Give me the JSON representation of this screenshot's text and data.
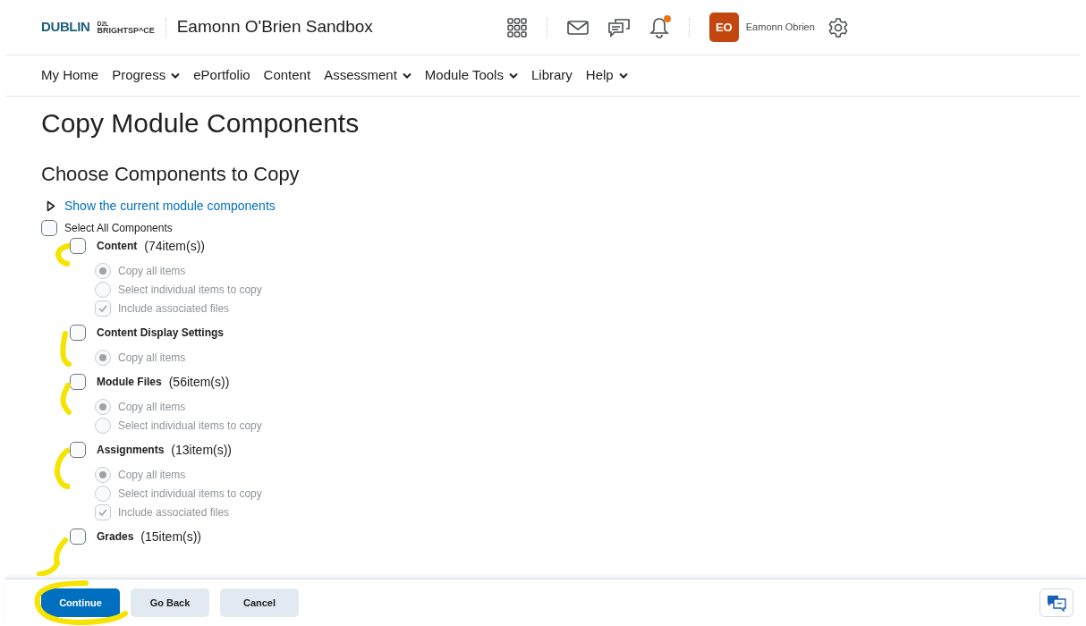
{
  "header": {
    "logo_text": "DUBLIN",
    "brand": "BRIGHTSP^CE",
    "brand_top": "D2L",
    "module_title": "Eamonn O'Brien Sandbox",
    "avatar_initials": "EO",
    "user_name": "Eamonn Obrien",
    "notification_dot": true
  },
  "nav": [
    {
      "label": "My Home",
      "menu": false
    },
    {
      "label": "Progress",
      "menu": true
    },
    {
      "label": "ePortfolio",
      "menu": false
    },
    {
      "label": "Content",
      "menu": false
    },
    {
      "label": "Assessment",
      "menu": true
    },
    {
      "label": "Module Tools",
      "menu": true
    },
    {
      "label": "Library",
      "menu": false
    },
    {
      "label": "Help",
      "menu": true
    }
  ],
  "page_title": "Copy Module Components",
  "section_title": "Choose Components to Copy",
  "show_link": "Show the current module components",
  "select_all": {
    "label": "Select All Components",
    "checked": false
  },
  "components": [
    {
      "name": "Content",
      "count": "(74item(s))",
      "checked": false,
      "options": [
        {
          "kind": "radio",
          "label": "Copy all items",
          "selected": true
        },
        {
          "kind": "radio",
          "label": "Select individual items to copy",
          "selected": false
        },
        {
          "kind": "checkbox",
          "label": "Include associated files",
          "checked": true
        }
      ]
    },
    {
      "name": "Content Display Settings",
      "checked": false,
      "options": [
        {
          "kind": "radio",
          "label": "Copy all items",
          "selected": true
        }
      ]
    },
    {
      "name": "Module Files",
      "count": "(56item(s))",
      "checked": false,
      "options": [
        {
          "kind": "radio",
          "label": "Copy all items",
          "selected": true
        },
        {
          "kind": "radio",
          "label": "Select individual items to copy",
          "selected": false
        }
      ]
    },
    {
      "name": "Assignments",
      "count": "(13item(s))",
      "checked": false,
      "options": [
        {
          "kind": "radio",
          "label": "Copy all items",
          "selected": true
        },
        {
          "kind": "radio",
          "label": "Select individual items to copy",
          "selected": false
        },
        {
          "kind": "checkbox",
          "label": "Include associated files",
          "checked": true
        }
      ]
    },
    {
      "name": "Grades",
      "count": "(15item(s))",
      "checked": false
    }
  ],
  "footer": {
    "buttons": [
      {
        "label": "Continue",
        "kind": "primary"
      },
      {
        "label": "Go Back",
        "kind": "secondary"
      },
      {
        "label": "Cancel",
        "kind": "secondary"
      }
    ]
  }
}
